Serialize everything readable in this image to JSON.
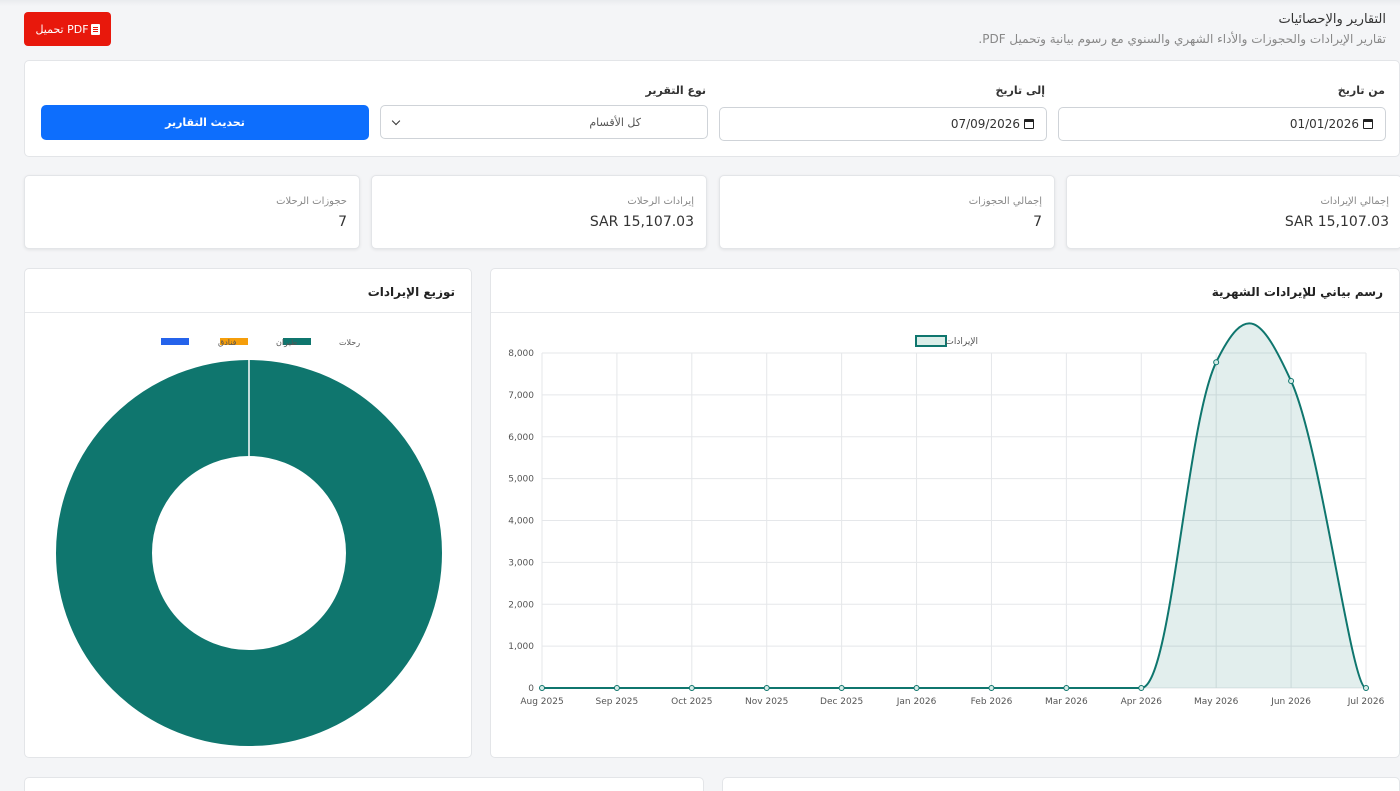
{
  "header": {
    "pdf_button": "تحميل PDF",
    "title": "التقارير والإحصائيات",
    "subtitle": "تقارير الإيرادات والحجوزات والأداء الشهري والسنوي مع رسوم بيانية وتحميل PDF."
  },
  "filters": {
    "from_label": "من تاريخ",
    "from_value": "01/01/2026",
    "to_label": "إلى تاريخ",
    "to_value": "07/09/2026",
    "type_label": "نوع التقرير",
    "type_value": "كل الأقسام",
    "update_button": "تحديث التقارير"
  },
  "stats": [
    {
      "label": "إجمالي الإيرادات",
      "value": "SAR 15,107.03"
    },
    {
      "label": "إجمالي الحجوزات",
      "value": "7"
    },
    {
      "label": "إيرادات الرحلات",
      "value": "SAR 15,107.03"
    },
    {
      "label": "حجوزات الرحلات",
      "value": "7"
    }
  ],
  "colors": {
    "accent": "#0d6efd",
    "pdf": "#e8180c",
    "teal": "#0f766e",
    "orange": "#f59e0b",
    "blue": "#2563eb"
  },
  "chart_data": [
    {
      "type": "line",
      "title": "رسم بياني للإيرادات الشهرية",
      "legend": "الإيرادات",
      "legend_position": "top",
      "x": [
        "Aug 2025",
        "Sep 2025",
        "Oct 2025",
        "Nov 2025",
        "Dec 2025",
        "Jan 2026",
        "Feb 2026",
        "Mar 2026",
        "Apr 2026",
        "May 2026",
        "Jun 2026",
        "Jul 2026"
      ],
      "series": [
        {
          "name": "الإيرادات",
          "values": [
            0,
            0,
            0,
            0,
            0,
            0,
            0,
            0,
            0,
            7780,
            7330,
            0
          ]
        }
      ],
      "ylim": [
        0,
        8000
      ],
      "yticks": [
        "0",
        "1,000",
        "2,000",
        "3,000",
        "4,000",
        "5,000",
        "6,000",
        "7,000",
        "8,000"
      ],
      "grid": true,
      "fill": true
    },
    {
      "type": "pie",
      "title": "توزيع الإيرادات",
      "legend_position": "top",
      "labels": [
        "رحلات",
        "طيران",
        "فنادق"
      ],
      "values": [
        15107.03,
        0,
        0
      ],
      "colors": [
        "#0f766e",
        "#f59e0b",
        "#2563eb"
      ]
    }
  ]
}
